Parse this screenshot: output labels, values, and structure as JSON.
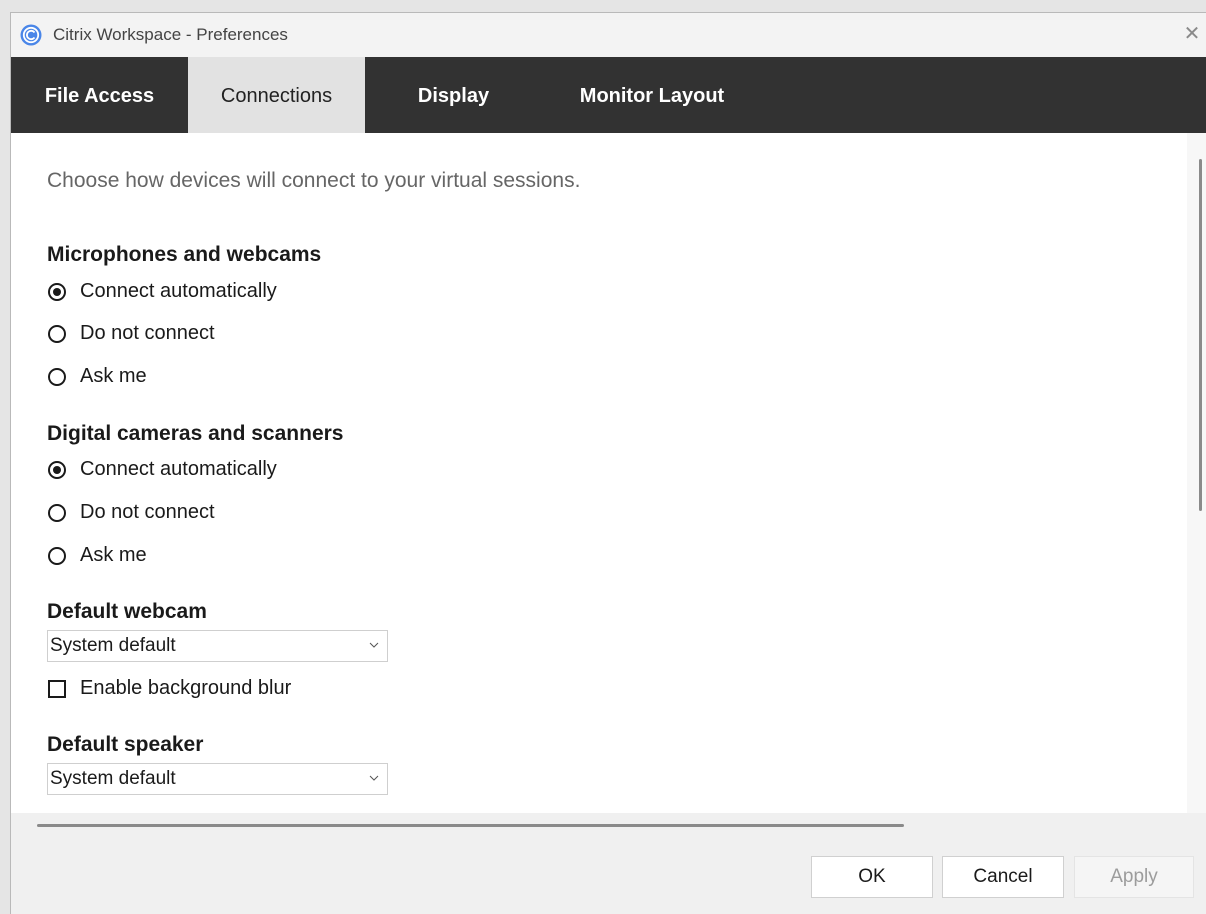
{
  "window": {
    "title": "Citrix Workspace - Preferences",
    "close_symbol": "✕"
  },
  "tabs": [
    {
      "label": "File Access",
      "active": false
    },
    {
      "label": "Connections",
      "active": true
    },
    {
      "label": "Display",
      "active": false
    },
    {
      "label": "Monitor Layout",
      "active": false
    }
  ],
  "content": {
    "intro": "Choose how devices will connect to your virtual sessions.",
    "microphones": {
      "heading": "Microphones and webcams",
      "options": [
        {
          "label": "Connect automatically",
          "checked": true
        },
        {
          "label": "Do not connect",
          "checked": false
        },
        {
          "label": "Ask me",
          "checked": false
        }
      ]
    },
    "cameras": {
      "heading": "Digital cameras and scanners",
      "options": [
        {
          "label": "Connect automatically",
          "checked": true
        },
        {
          "label": "Do not connect",
          "checked": false
        },
        {
          "label": "Ask me",
          "checked": false
        }
      ]
    },
    "webcam": {
      "heading": "Default webcam",
      "selected": "System default",
      "blur_label": "Enable background blur",
      "blur_checked": false
    },
    "speaker": {
      "heading": "Default speaker",
      "selected": "System default"
    }
  },
  "footer": {
    "ok_label": "OK",
    "cancel_label": "Cancel",
    "apply_label": "Apply"
  },
  "icons": {
    "app": "citrix-workspace-icon",
    "close": "close-icon",
    "chevron": "chevron-down-icon"
  },
  "colors": {
    "tabbar_bg": "#323232",
    "active_tab_bg": "#e2e2e2",
    "app_icon_blue": "#3d7ee0"
  }
}
